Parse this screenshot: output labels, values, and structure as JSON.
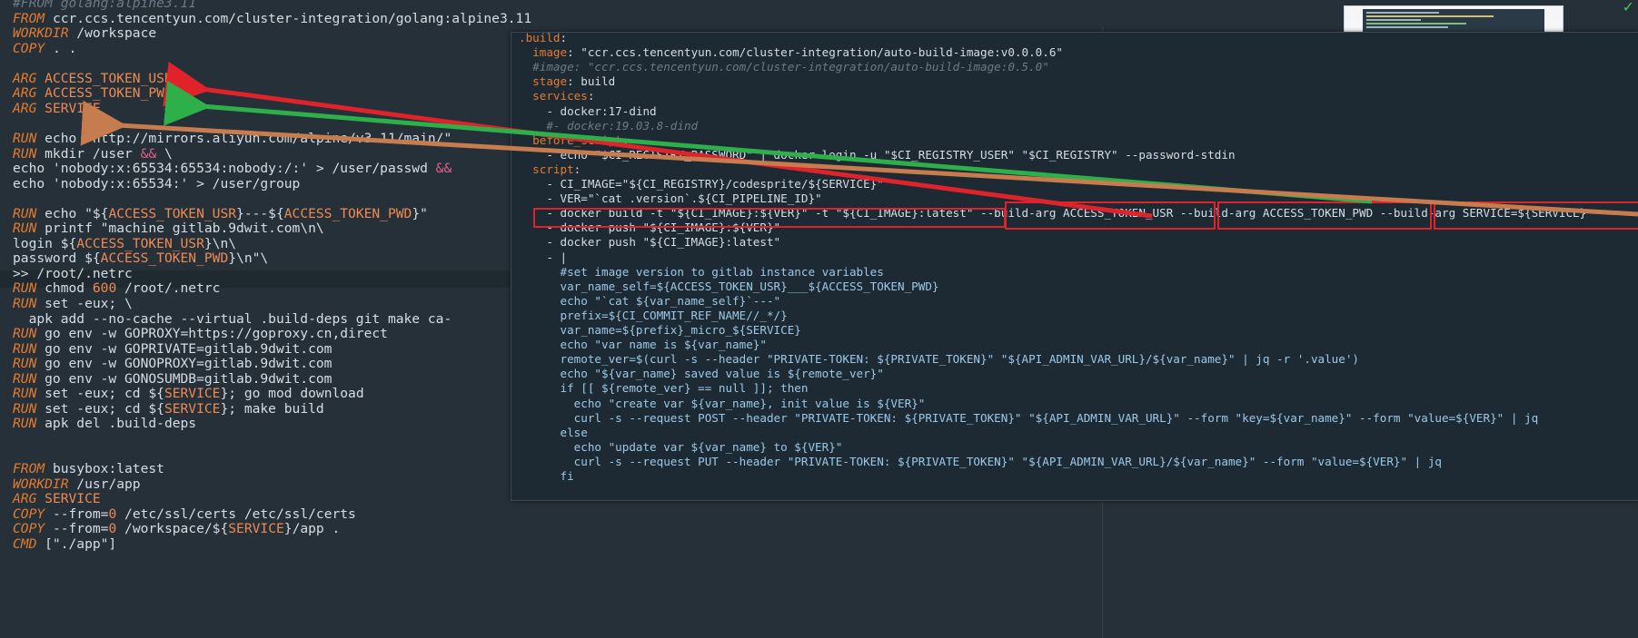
{
  "left_editor": {
    "lines": [
      "#FROM golang:alpine3.11",
      "FROM ccr.ccs.tencentyun.com/cluster-integration/golang:alpine3.11",
      "WORKDIR /workspace",
      "COPY . .",
      "",
      "ARG ACCESS_TOKEN_USR",
      "ARG ACCESS_TOKEN_PWD",
      "ARG SERVICE",
      "",
      "RUN echo \"http://mirrors.aliyun.com/alpine/v3.11/main/\"",
      "RUN mkdir /user && \\",
      "echo 'nobody:x:65534:65534:nobody:/:' > /user/passwd &&",
      "echo 'nobody:x:65534:' > /user/group",
      "",
      "RUN echo \"${ACCESS_TOKEN_USR}---${ACCESS_TOKEN_PWD}\"",
      "RUN printf \"machine gitlab.9dwit.com\\n\\",
      "login ${ACCESS_TOKEN_USR}\\n\\",
      "password ${ACCESS_TOKEN_PWD}\\n\"\\",
      ">> /root/.netrc",
      "RUN chmod 600 /root/.netrc",
      "RUN set -eux; \\",
      "  apk add --no-cache --virtual .build-deps git make ca-",
      "RUN go env -w GOPROXY=https://goproxy.cn,direct",
      "RUN go env -w GOPRIVATE=gitlab.9dwit.com",
      "RUN go env -w GONOPROXY=gitlab.9dwit.com",
      "RUN go env -w GONOSUMDB=gitlab.9dwit.com",
      "RUN set -eux; cd ${SERVICE}; go mod download",
      "RUN set -eux; cd ${SERVICE}; make build",
      "RUN apk del .build-deps",
      "",
      "",
      "FROM busybox:latest",
      "WORKDIR /usr/app",
      "ARG SERVICE",
      "COPY --from=0 /etc/ssl/certs /etc/ssl/certs",
      "COPY --from=0 /workspace/${SERVICE}/app .",
      "CMD [\"./app\"]"
    ]
  },
  "overlay": {
    "lines": [
      ".build:",
      "  image: \"ccr.ccs.tencentyun.com/cluster-integration/auto-build-image:v0.0.0.6\"",
      "  #image: \"ccr.ccs.tencentyun.com/cluster-integration/auto-build-image:0.5.0\"",
      "  stage: build",
      "  services:",
      "    - docker:17-dind",
      "    #- docker:19.03.8-dind",
      "  before_script:",
      "    - echo \"$CI_REGISTRY_PASSWORD\" | docker login -u \"$CI_REGISTRY_USER\" \"$CI_REGISTRY\" --password-stdin",
      "  script:",
      "    - CI_IMAGE=\"${CI_REGISTRY}/codesprite/${SERVICE}\"",
      "    - VER=\"`cat .version`.${CI_PIPELINE_ID}\"",
      "    - docker build -t \"${CI_IMAGE}:${VER}\" -t \"${CI_IMAGE}:latest\" --build-arg ACCESS_TOKEN_USR --build-arg ACCESS_TOKEN_PWD --build-arg SERVICE=${SERVICE}",
      "    - docker push \"${CI_IMAGE}:${VER}\"",
      "    - docker push \"${CI_IMAGE}:latest\"",
      "    - |",
      "      #set image version to gitlab instance variables",
      "      var_name_self=${ACCESS_TOKEN_USR}___${ACCESS_TOKEN_PWD}",
      "      echo \"`cat ${var_name_self}`---\"",
      "      prefix=${CI_COMMIT_REF_NAME//_*/}",
      "      var_name=${prefix}_micro_${SERVICE}",
      "      echo \"var name is ${var_name}\"",
      "      remote_ver=$(curl -s --header \"PRIVATE-TOKEN: ${PRIVATE_TOKEN}\" \"${API_ADMIN_VAR_URL}/${var_name}\" | jq -r '.value')",
      "      echo \"${var_name} saved value is ${remote_ver}\"",
      "      if [[ ${remote_ver} == null ]]; then",
      "        echo \"create var ${var_name}, init value is ${VER}\"",
      "        curl -s --request POST --header \"PRIVATE-TOKEN: ${PRIVATE_TOKEN}\" \"${API_ADMIN_VAR_URL}\" --form \"key=${var_name}\" --form \"value=${VER}\" | jq",
      "      else",
      "        echo \"update var ${var_name} to ${VER}\"",
      "        curl -s --request PUT --header \"PRIVATE-TOKEN: ${PRIVATE_TOKEN}\" \"${API_ADMIN_VAR_URL}/${var_name}\" --form \"value=${VER}\" | jq",
      "      fi"
    ],
    "highlight_boxes": [
      "docker build",
      "--build-arg ACCESS_TOKEN_USR",
      "--build-arg ACCESS_TOKEN_PWD",
      "--build-arg SERVICE=${SERVICE}"
    ]
  },
  "colors": {
    "editor_bg": "#263039",
    "keyword": "#e47b2f",
    "string": "#b8d66a",
    "variable": "#ef8a52",
    "comment": "#6b7a86",
    "arrow_red": "#e0232a",
    "arrow_green": "#2db04a",
    "arrow_brown": "#c67c4e",
    "check": "#4cc55a"
  }
}
